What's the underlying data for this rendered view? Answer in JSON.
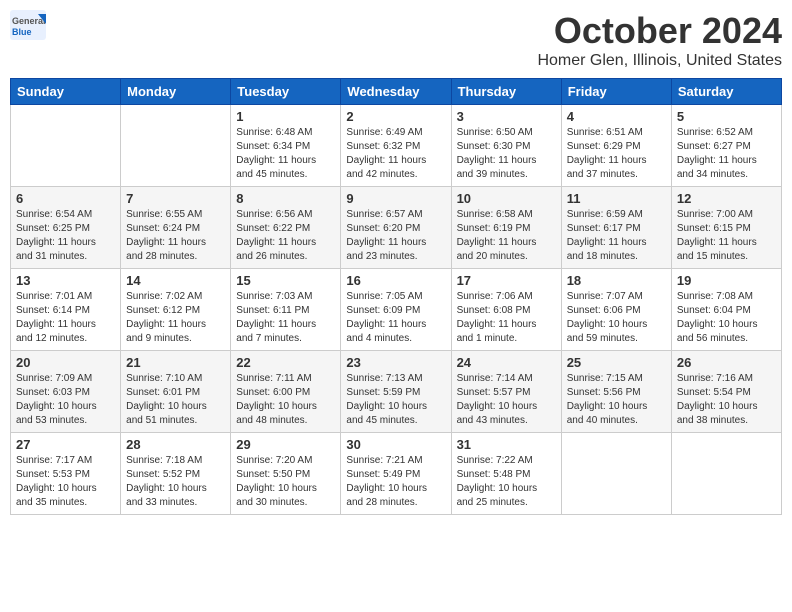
{
  "header": {
    "logo_general": "General",
    "logo_blue": "Blue",
    "month_title": "October 2024",
    "location": "Homer Glen, Illinois, United States"
  },
  "days_of_week": [
    "Sunday",
    "Monday",
    "Tuesday",
    "Wednesday",
    "Thursday",
    "Friday",
    "Saturday"
  ],
  "weeks": [
    [
      {
        "day": "",
        "text": ""
      },
      {
        "day": "",
        "text": ""
      },
      {
        "day": "1",
        "text": "Sunrise: 6:48 AM\nSunset: 6:34 PM\nDaylight: 11 hours\nand 45 minutes."
      },
      {
        "day": "2",
        "text": "Sunrise: 6:49 AM\nSunset: 6:32 PM\nDaylight: 11 hours\nand 42 minutes."
      },
      {
        "day": "3",
        "text": "Sunrise: 6:50 AM\nSunset: 6:30 PM\nDaylight: 11 hours\nand 39 minutes."
      },
      {
        "day": "4",
        "text": "Sunrise: 6:51 AM\nSunset: 6:29 PM\nDaylight: 11 hours\nand 37 minutes."
      },
      {
        "day": "5",
        "text": "Sunrise: 6:52 AM\nSunset: 6:27 PM\nDaylight: 11 hours\nand 34 minutes."
      }
    ],
    [
      {
        "day": "6",
        "text": "Sunrise: 6:54 AM\nSunset: 6:25 PM\nDaylight: 11 hours\nand 31 minutes."
      },
      {
        "day": "7",
        "text": "Sunrise: 6:55 AM\nSunset: 6:24 PM\nDaylight: 11 hours\nand 28 minutes."
      },
      {
        "day": "8",
        "text": "Sunrise: 6:56 AM\nSunset: 6:22 PM\nDaylight: 11 hours\nand 26 minutes."
      },
      {
        "day": "9",
        "text": "Sunrise: 6:57 AM\nSunset: 6:20 PM\nDaylight: 11 hours\nand 23 minutes."
      },
      {
        "day": "10",
        "text": "Sunrise: 6:58 AM\nSunset: 6:19 PM\nDaylight: 11 hours\nand 20 minutes."
      },
      {
        "day": "11",
        "text": "Sunrise: 6:59 AM\nSunset: 6:17 PM\nDaylight: 11 hours\nand 18 minutes."
      },
      {
        "day": "12",
        "text": "Sunrise: 7:00 AM\nSunset: 6:15 PM\nDaylight: 11 hours\nand 15 minutes."
      }
    ],
    [
      {
        "day": "13",
        "text": "Sunrise: 7:01 AM\nSunset: 6:14 PM\nDaylight: 11 hours\nand 12 minutes."
      },
      {
        "day": "14",
        "text": "Sunrise: 7:02 AM\nSunset: 6:12 PM\nDaylight: 11 hours\nand 9 minutes."
      },
      {
        "day": "15",
        "text": "Sunrise: 7:03 AM\nSunset: 6:11 PM\nDaylight: 11 hours\nand 7 minutes."
      },
      {
        "day": "16",
        "text": "Sunrise: 7:05 AM\nSunset: 6:09 PM\nDaylight: 11 hours\nand 4 minutes."
      },
      {
        "day": "17",
        "text": "Sunrise: 7:06 AM\nSunset: 6:08 PM\nDaylight: 11 hours\nand 1 minute."
      },
      {
        "day": "18",
        "text": "Sunrise: 7:07 AM\nSunset: 6:06 PM\nDaylight: 10 hours\nand 59 minutes."
      },
      {
        "day": "19",
        "text": "Sunrise: 7:08 AM\nSunset: 6:04 PM\nDaylight: 10 hours\nand 56 minutes."
      }
    ],
    [
      {
        "day": "20",
        "text": "Sunrise: 7:09 AM\nSunset: 6:03 PM\nDaylight: 10 hours\nand 53 minutes."
      },
      {
        "day": "21",
        "text": "Sunrise: 7:10 AM\nSunset: 6:01 PM\nDaylight: 10 hours\nand 51 minutes."
      },
      {
        "day": "22",
        "text": "Sunrise: 7:11 AM\nSunset: 6:00 PM\nDaylight: 10 hours\nand 48 minutes."
      },
      {
        "day": "23",
        "text": "Sunrise: 7:13 AM\nSunset: 5:59 PM\nDaylight: 10 hours\nand 45 minutes."
      },
      {
        "day": "24",
        "text": "Sunrise: 7:14 AM\nSunset: 5:57 PM\nDaylight: 10 hours\nand 43 minutes."
      },
      {
        "day": "25",
        "text": "Sunrise: 7:15 AM\nSunset: 5:56 PM\nDaylight: 10 hours\nand 40 minutes."
      },
      {
        "day": "26",
        "text": "Sunrise: 7:16 AM\nSunset: 5:54 PM\nDaylight: 10 hours\nand 38 minutes."
      }
    ],
    [
      {
        "day": "27",
        "text": "Sunrise: 7:17 AM\nSunset: 5:53 PM\nDaylight: 10 hours\nand 35 minutes."
      },
      {
        "day": "28",
        "text": "Sunrise: 7:18 AM\nSunset: 5:52 PM\nDaylight: 10 hours\nand 33 minutes."
      },
      {
        "day": "29",
        "text": "Sunrise: 7:20 AM\nSunset: 5:50 PM\nDaylight: 10 hours\nand 30 minutes."
      },
      {
        "day": "30",
        "text": "Sunrise: 7:21 AM\nSunset: 5:49 PM\nDaylight: 10 hours\nand 28 minutes."
      },
      {
        "day": "31",
        "text": "Sunrise: 7:22 AM\nSunset: 5:48 PM\nDaylight: 10 hours\nand 25 minutes."
      },
      {
        "day": "",
        "text": ""
      },
      {
        "day": "",
        "text": ""
      }
    ]
  ]
}
